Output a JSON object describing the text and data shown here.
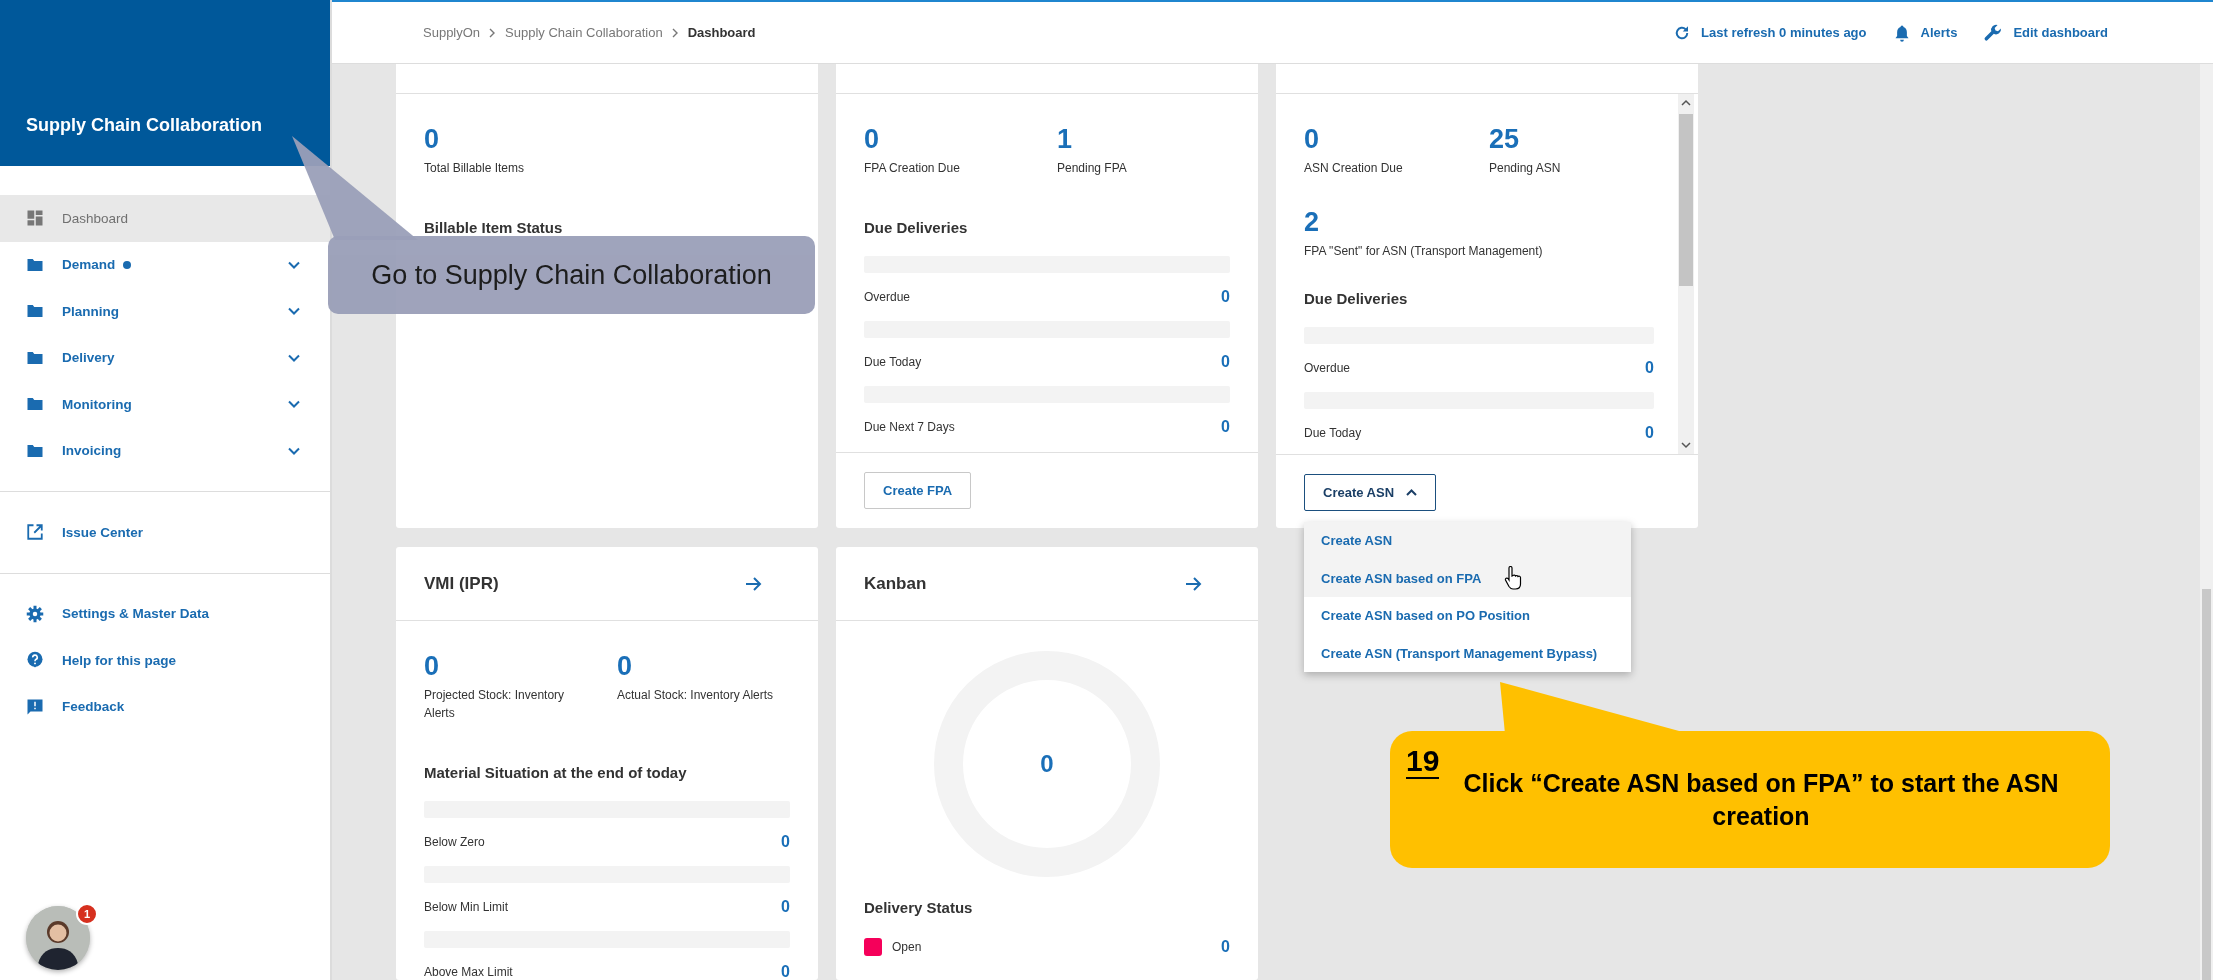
{
  "sidebar": {
    "title": "Supply Chain Collaboration",
    "nav": [
      {
        "label": "Dashboard",
        "kind": "dashboard",
        "selected": true
      },
      {
        "label": "Demand",
        "kind": "folder",
        "selected": false,
        "dot": true,
        "expanded": false
      },
      {
        "label": "Planning",
        "kind": "folder",
        "selected": false,
        "dot": false,
        "expanded": false
      },
      {
        "label": "Delivery",
        "kind": "folder",
        "selected": false,
        "dot": false,
        "expanded": false
      },
      {
        "label": "Monitoring",
        "kind": "folder",
        "selected": false,
        "dot": false,
        "expanded": false
      },
      {
        "label": "Invoicing",
        "kind": "folder",
        "selected": false,
        "dot": false,
        "expanded": false
      }
    ],
    "links": [
      {
        "label": "Issue Center",
        "kind": "external"
      }
    ],
    "utility": [
      {
        "label": "Settings & Master Data",
        "kind": "settings"
      },
      {
        "label": "Help for this page",
        "kind": "help"
      },
      {
        "label": "Feedback",
        "kind": "feedback"
      }
    ],
    "avatar": {
      "badge": "1"
    }
  },
  "topbar": {
    "breadcrumb": [
      {
        "label": "SupplyOn",
        "current": false
      },
      {
        "label": "Supply Chain Collaboration",
        "current": false
      },
      {
        "label": "Dashboard",
        "current": true
      }
    ],
    "actions": [
      {
        "label": "Last refresh 0 minutes ago",
        "kind": "refresh"
      },
      {
        "label": "Alerts",
        "kind": "alerts"
      },
      {
        "label": "Edit dashboard",
        "kind": "edit"
      }
    ]
  },
  "cards": [
    {
      "kind": "stats",
      "stats": [
        {
          "value": "0",
          "label": "Total Billable Items"
        }
      ],
      "heading": "Billable Item Status"
    },
    {
      "kind": "stats",
      "stats": [
        {
          "value": "0",
          "label": "FPA Creation Due"
        },
        {
          "value": "1",
          "label": "Pending FPA"
        }
      ],
      "heading": "Due Deliveries",
      "rows": [
        {
          "label": "Overdue",
          "value": "0",
          "level": 0
        },
        {
          "label": "Due Today",
          "value": "0",
          "level": 0
        },
        {
          "label": "Due Next 7 Days",
          "value": "0",
          "level": 0
        }
      ],
      "button": {
        "label": "Create FPA"
      }
    },
    {
      "kind": "stats",
      "scroll": true,
      "stats": [
        {
          "value": "0",
          "label": "ASN Creation Due"
        },
        {
          "value": "25",
          "label": "Pending ASN"
        },
        {
          "value": "2",
          "label": "FPA \"Sent\" for ASN (Transport Management)"
        }
      ],
      "heading": "Due Deliveries",
      "rows": [
        {
          "label": "Overdue",
          "value": "0",
          "level": 0
        },
        {
          "label": "Due Today",
          "value": "0",
          "level": 0
        }
      ],
      "button": {
        "label": "Create ASN",
        "expanded": true,
        "menu": [
          {
            "label": "Create ASN",
            "highlighted": true
          },
          {
            "label": "Create ASN based on FPA",
            "highlighted": true
          },
          {
            "label": "Create ASN based on PO Position",
            "highlighted": false
          },
          {
            "label": "Create ASN (Transport Management Bypass)",
            "highlighted": false
          }
        ]
      }
    },
    {
      "kind": "stats",
      "title": "VMI (IPR)",
      "stats": [
        {
          "value": "0",
          "label": "Projected Stock: Inventory Alerts"
        },
        {
          "value": "0",
          "label": "Actual Stock: Inventory Alerts"
        }
      ],
      "heading": "Material Situation at the end of today",
      "rows": [
        {
          "label": "Below Zero",
          "value": "0",
          "level": 0
        },
        {
          "label": "Below Min Limit",
          "value": "0",
          "level": 0
        },
        {
          "label": "Above Max Limit",
          "value": "0",
          "level": 0
        }
      ]
    },
    {
      "kind": "kanban",
      "title": "Kanban",
      "donut_value": "0",
      "heading": "Delivery Status",
      "legend": [
        {
          "label": "Open",
          "value": "0",
          "color": "#f5005a"
        }
      ]
    }
  ],
  "callouts": [
    {
      "kind": "gray",
      "text": "Go to Supply Chain Collaboration"
    },
    {
      "kind": "yellow",
      "step": "19",
      "text": "Click “Create ASN based on FPA” to start the ASN creation"
    }
  ]
}
